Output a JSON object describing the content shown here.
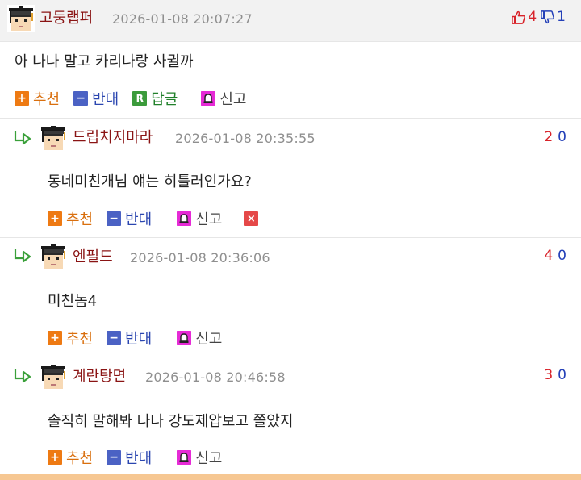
{
  "post": {
    "nick": "고둥랩퍼",
    "date": "2026-01-08 20:07:27",
    "up_count": "4",
    "down_count": "1",
    "body": "아 나나 말고 카리나랑 사귈까",
    "actions": {
      "recommend": "추천",
      "oppose": "반대",
      "reply": "답글",
      "report": "신고"
    }
  },
  "comments": [
    {
      "nick": "드립치지마라",
      "date": "2026-01-08 20:35:55",
      "up": "2",
      "down": "0",
      "body": "동네미친개님 얘는 히틀러인가요?",
      "recommend": "추천",
      "oppose": "반대",
      "report": "신고"
    },
    {
      "nick": "엔필드",
      "date": "2026-01-08 20:36:06",
      "up": "4",
      "down": "0",
      "body": "미친놈4",
      "recommend": "추천",
      "oppose": "반대",
      "report": "신고"
    },
    {
      "nick": "계란탕면",
      "date": "2026-01-08 20:46:58",
      "up": "3",
      "down": "0",
      "body": "솔직히 말해봐 나나 강도제압보고 쫄았지",
      "recommend": "추천",
      "oppose": "반대",
      "report": "신고"
    }
  ],
  "icons": {
    "plus": "+",
    "minus": "−",
    "reply": "R",
    "delete": "×",
    "avatar": "graduate-avatar-icon",
    "reply_arrow": "reply-arrow-icon",
    "thumbs_up": "thumbs-up-icon",
    "thumbs_down": "thumbs-down-icon",
    "report": "bell-icon"
  },
  "colors": {
    "nick": "#8a1414",
    "recommend": "#ee7a13",
    "oppose": "#4b62c4",
    "reply": "#3b9b3b",
    "report": "#e62ad6",
    "delete": "#e54848",
    "up": "#d8232a",
    "down": "#2440b8",
    "date": "#8f8f8f"
  }
}
